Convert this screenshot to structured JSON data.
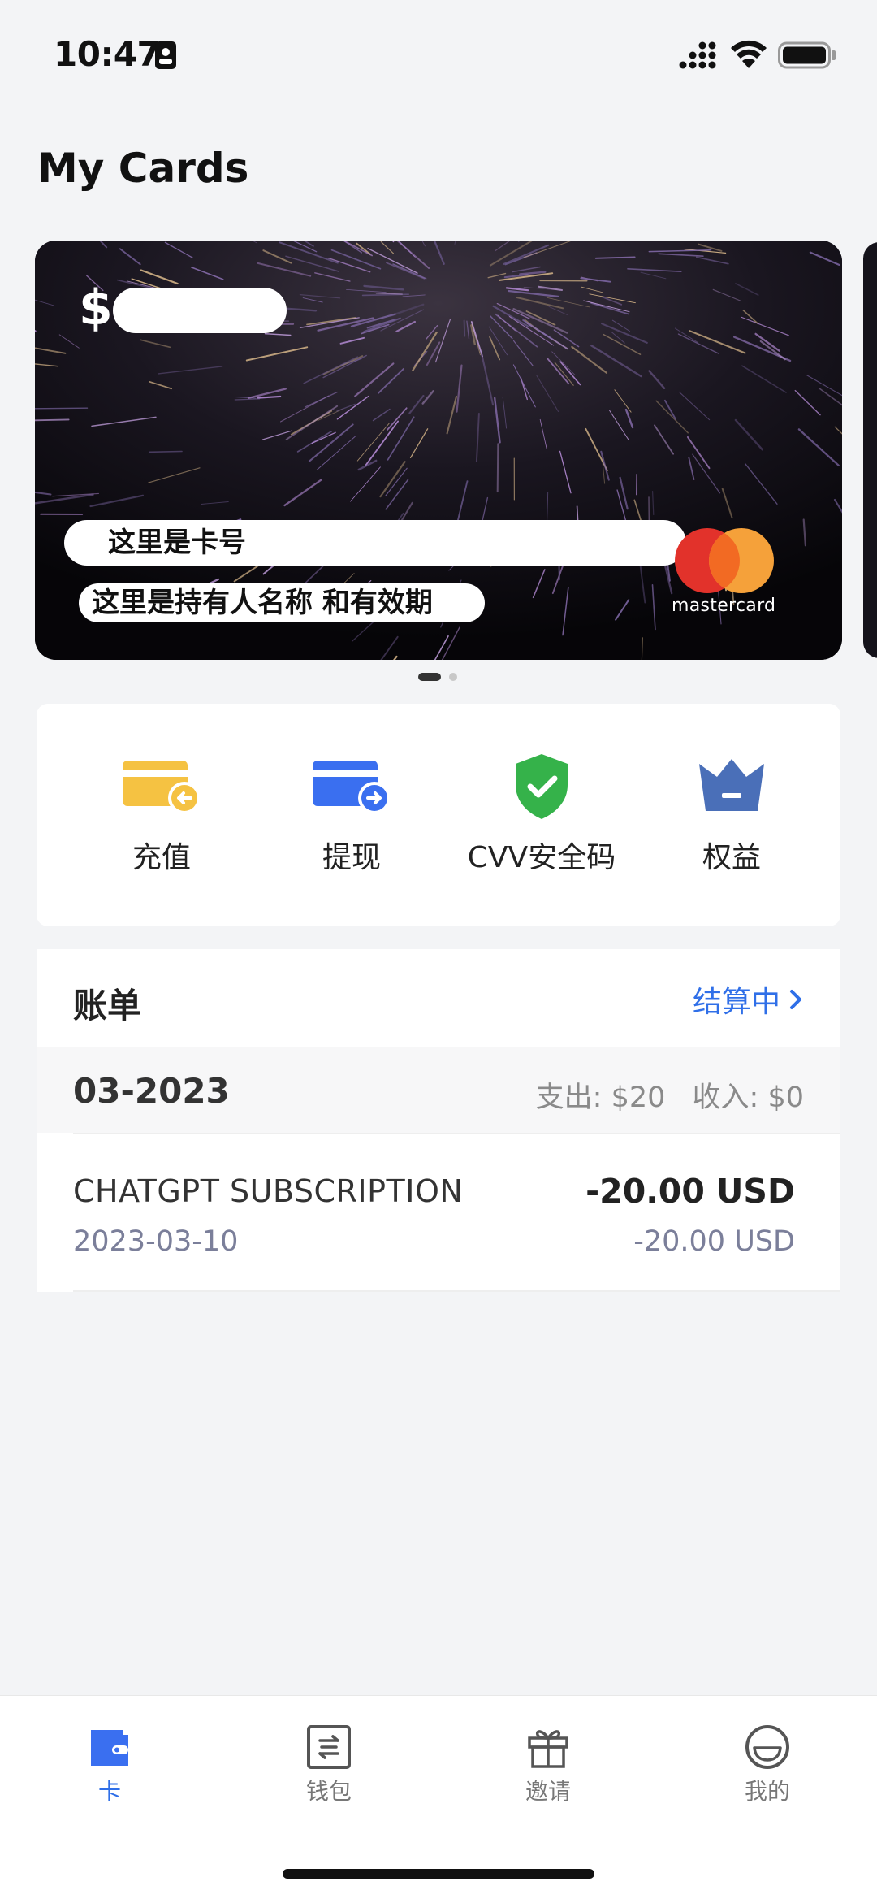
{
  "status_bar": {
    "time": "10:47"
  },
  "page": {
    "title": "My Cards"
  },
  "card": {
    "currency_symbol": "$",
    "number_placeholder": "这里是卡号",
    "holder_placeholder": "这里是持有人名称 和有效期",
    "network_text": "mastercard"
  },
  "pager": {
    "count": 2,
    "active_index": 0
  },
  "actions": [
    {
      "label": "充值",
      "icon": "card-topup-icon",
      "color": "#f5c242"
    },
    {
      "label": "提现",
      "icon": "card-withdraw-icon",
      "color": "#3a6ff0"
    },
    {
      "label": "CVV安全码",
      "icon": "shield-check-icon",
      "color": "#35b24a"
    },
    {
      "label": "权益",
      "icon": "crown-icon",
      "color": "#4a6fb8"
    }
  ],
  "bill": {
    "title": "账单",
    "status_link": "结算中",
    "month": "03-2023",
    "expense": "支出: $20",
    "income": "收入: $0",
    "transactions": [
      {
        "merchant": "CHATGPT SUBSCRIPTION",
        "date": "2023-03-10",
        "amount": "-20.00 USD",
        "amount_original": "-20.00 USD"
      }
    ]
  },
  "tabs": [
    {
      "label": "卡",
      "icon": "card-icon",
      "active": true
    },
    {
      "label": "钱包",
      "icon": "wallet-icon",
      "active": false
    },
    {
      "label": "邀请",
      "icon": "gift-icon",
      "active": false
    },
    {
      "label": "我的",
      "icon": "smile-icon",
      "active": false
    }
  ],
  "colors": {
    "accent": "#2f6fe8",
    "background": "#f3f4f6"
  }
}
